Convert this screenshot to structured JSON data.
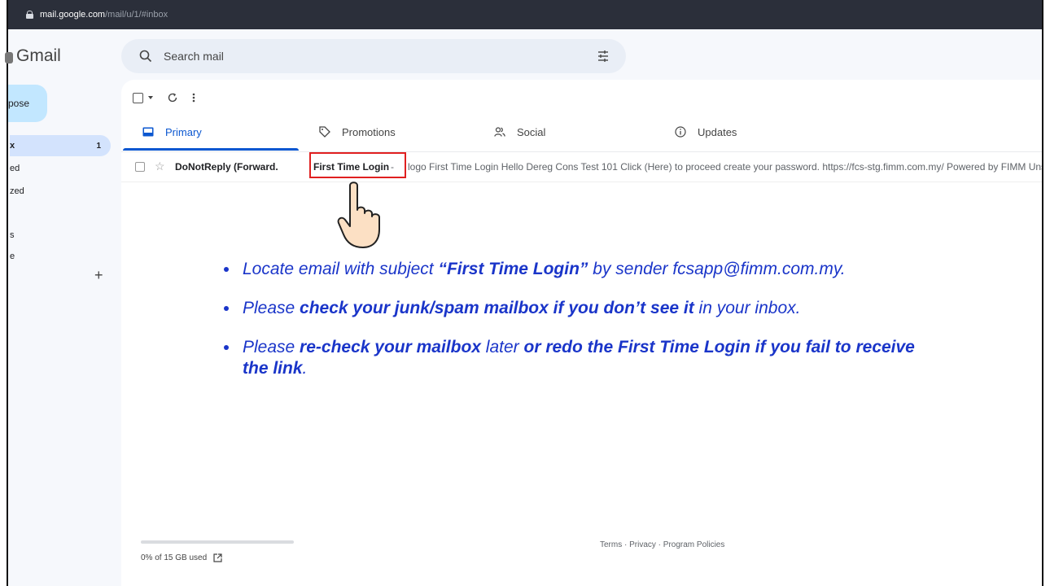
{
  "browser": {
    "url_domain": "mail.google.com",
    "url_path": "/mail/u/1/#inbox"
  },
  "app": {
    "name": "Gmail"
  },
  "search": {
    "placeholder": "Search mail"
  },
  "sidebar": {
    "compose_label": "pose",
    "items": [
      {
        "label": "x",
        "count": "1"
      },
      {
        "label": "ed"
      },
      {
        "label": "zed"
      },
      {
        "label": "s"
      },
      {
        "label": "e"
      }
    ]
  },
  "tabs": [
    {
      "label": "Primary",
      "icon": "inbox-icon"
    },
    {
      "label": "Promotions",
      "icon": "tag-icon"
    },
    {
      "label": "Social",
      "icon": "people-icon"
    },
    {
      "label": "Updates",
      "icon": "info-icon"
    }
  ],
  "email": {
    "sender": "DoNotReply (Forward.",
    "subject": "First Time Login",
    "separator": "-",
    "snippet": "logo First Time Login Hello Dereg Cons Test 101 Click (Here) to proceed create your password. https://fcs-stg.fimm.com.my/ Powered by FIMM Uns"
  },
  "instructions": [
    {
      "parts": [
        {
          "t": "Locate email with subject ",
          "b": false
        },
        {
          "t": "“First Time Login”",
          "b": true
        },
        {
          "t": " by sender fcsapp@fimm.com.my.",
          "b": false
        }
      ]
    },
    {
      "parts": [
        {
          "t": "Please ",
          "b": false
        },
        {
          "t": "check your junk/spam mailbox if you don’t see it",
          "b": true
        },
        {
          "t": " in your inbox.",
          "b": false
        }
      ]
    },
    {
      "parts": [
        {
          "t": "Please ",
          "b": false
        },
        {
          "t": "re-check your mailbox",
          "b": true
        },
        {
          "t": " later ",
          "b": false
        },
        {
          "t": "or redo the First Time Login if you fail to receive the link",
          "b": true
        },
        {
          "t": ".",
          "b": false
        }
      ]
    }
  ],
  "footer": {
    "storage_text": "0% of 15 GB used",
    "storage_fraction": 0.0,
    "links_text": "Terms · Privacy · Program Policies"
  },
  "colors": {
    "accent": "#0b57d0",
    "instruction_text": "#1a35c9",
    "highlight": "#e02020"
  }
}
